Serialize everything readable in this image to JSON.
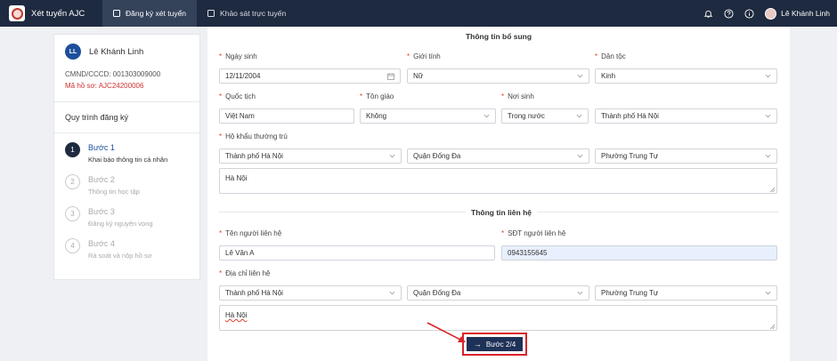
{
  "app": {
    "title": "Xét tuyển AJC"
  },
  "nav": {
    "tab_register": "Đăng ký xét tuyển",
    "tab_survey": "Khảo sát trực tuyến"
  },
  "user": {
    "name": "Lê Khánh Linh"
  },
  "profile": {
    "initials": "LL",
    "name": "Lê Khánh Linh",
    "id_line": "CMND/CCCD: 001303009000",
    "code_line": "Mã hồ sơ: AJC24200006"
  },
  "process": {
    "title": "Quy trình đăng ký",
    "steps": [
      {
        "num": "1",
        "title": "Bước 1",
        "sub": "Khai báo thông tin cá nhân"
      },
      {
        "num": "2",
        "title": "Bước 2",
        "sub": "Thông tin học tập"
      },
      {
        "num": "3",
        "title": "Bước 3",
        "sub": "Đăng ký nguyện vọng"
      },
      {
        "num": "4",
        "title": "Bước 4",
        "sub": "Rà soát và nộp hồ sơ"
      }
    ]
  },
  "extra": {
    "title": "Thông tin bổ sung",
    "dob_label": "Ngày sinh",
    "dob_value": "12/11/2004",
    "gender_label": "Giới tính",
    "gender_value": "Nữ",
    "ethnic_label": "Dân tộc",
    "ethnic_value": "Kinh",
    "nationality_label": "Quốc tịch",
    "nationality_value": "Việt Nam",
    "religion_label": "Tôn giáo",
    "religion_value": "Không",
    "birthplace_label": "Nơi sinh",
    "birthplace_type": "Trong nước",
    "birthplace_value": "Thành phố Hà Nội",
    "residence_label": "Hộ khẩu thường trú",
    "res_city": "Thành phố Hà Nội",
    "res_district": "Quận Đống Đa",
    "res_ward": "Phường Trung Tự",
    "res_address": "Hà Nội"
  },
  "contact": {
    "title": "Thông tin liên hệ",
    "name_label": "Tên người liên hệ",
    "name_value": "Lê Văn A",
    "phone_label": "SĐT người liên hệ",
    "phone_value": "0943155645",
    "address_label": "Địa chỉ liên hệ",
    "city": "Thành phố Hà Nội",
    "district": "Quận Đống Đa",
    "ward": "Phường Trung Tự",
    "address": "Hà Nội"
  },
  "actions": {
    "next_label": "Bước 2/4",
    "next_icon": "arrow-right-icon"
  },
  "colors": {
    "topbar": "#1e2a3f",
    "accent": "#1c4f9c",
    "required": "#e0402f",
    "highlight": "#d8242a"
  }
}
